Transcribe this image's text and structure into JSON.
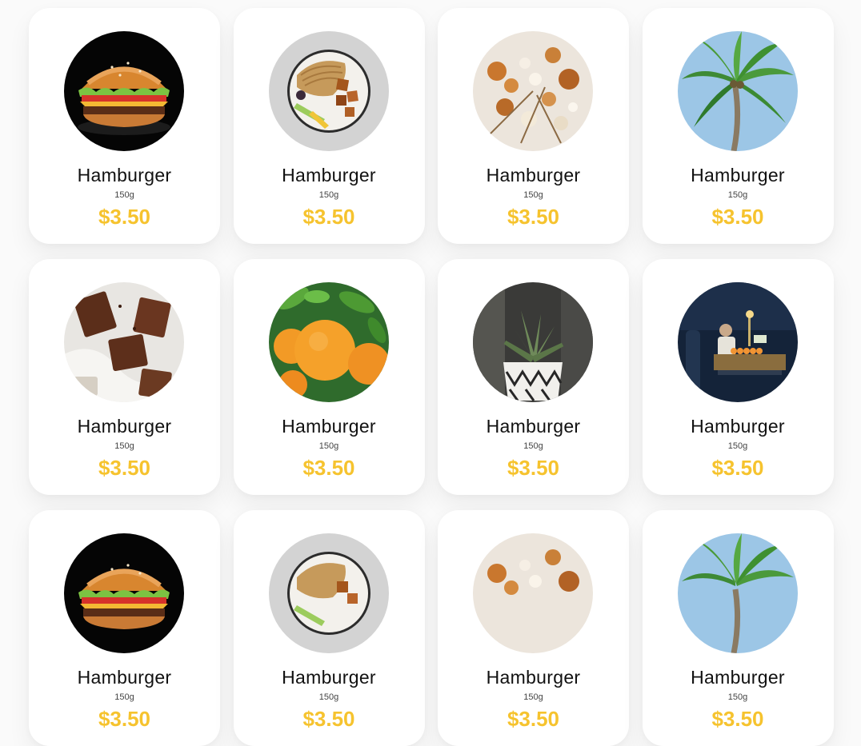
{
  "accent_color": "#f6c32e",
  "products": [
    {
      "name": "Hamburger",
      "weight": "150g",
      "price": "$3.50",
      "image": "burger"
    },
    {
      "name": "Hamburger",
      "weight": "150g",
      "price": "$3.50",
      "image": "noodle-bowl"
    },
    {
      "name": "Hamburger",
      "weight": "150g",
      "price": "$3.50",
      "image": "dried-flowers"
    },
    {
      "name": "Hamburger",
      "weight": "150g",
      "price": "$3.50",
      "image": "palm-tree"
    },
    {
      "name": "Hamburger",
      "weight": "150g",
      "price": "$3.50",
      "image": "brownies"
    },
    {
      "name": "Hamburger",
      "weight": "150g",
      "price": "$3.50",
      "image": "oranges"
    },
    {
      "name": "Hamburger",
      "weight": "150g",
      "price": "$3.50",
      "image": "succulent"
    },
    {
      "name": "Hamburger",
      "weight": "150g",
      "price": "$3.50",
      "image": "market-stall"
    },
    {
      "name": "Hamburger",
      "weight": "150g",
      "price": "$3.50",
      "image": "burger"
    },
    {
      "name": "Hamburger",
      "weight": "150g",
      "price": "$3.50",
      "image": "noodle-bowl"
    },
    {
      "name": "Hamburger",
      "weight": "150g",
      "price": "$3.50",
      "image": "dried-flowers"
    },
    {
      "name": "Hamburger",
      "weight": "150g",
      "price": "$3.50",
      "image": "palm-tree"
    }
  ]
}
